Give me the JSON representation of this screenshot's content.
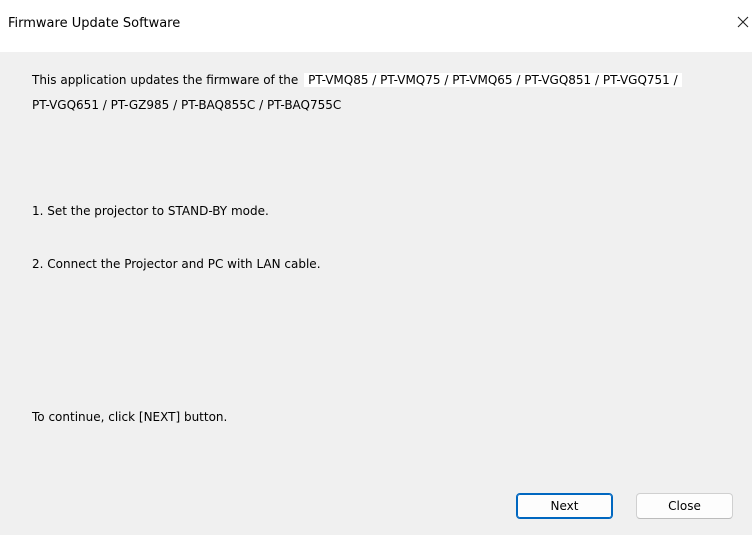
{
  "window": {
    "title": "Firmware Update Software",
    "close_icon": "close-icon"
  },
  "content": {
    "intro_prefix": "This application updates the firmware of the",
    "models_line1": "PT-VMQ85 / PT-VMQ75 / PT-VMQ65 / PT-VGQ851 / PT-VGQ751 /",
    "models_line2": "PT-VGQ651 / PT-GZ985 / PT-BAQ855C / PT-BAQ755C",
    "step1": "1. Set the projector to STAND-BY mode.",
    "step2": "2. Connect the Projector and PC with LAN cable.",
    "continue_hint": "To continue, click [NEXT] button."
  },
  "buttons": {
    "next_label": "Next",
    "close_label": "Close"
  },
  "colors": {
    "accent": "#0067c0",
    "background": "#f0f0f0",
    "titlebar": "#ffffff"
  }
}
